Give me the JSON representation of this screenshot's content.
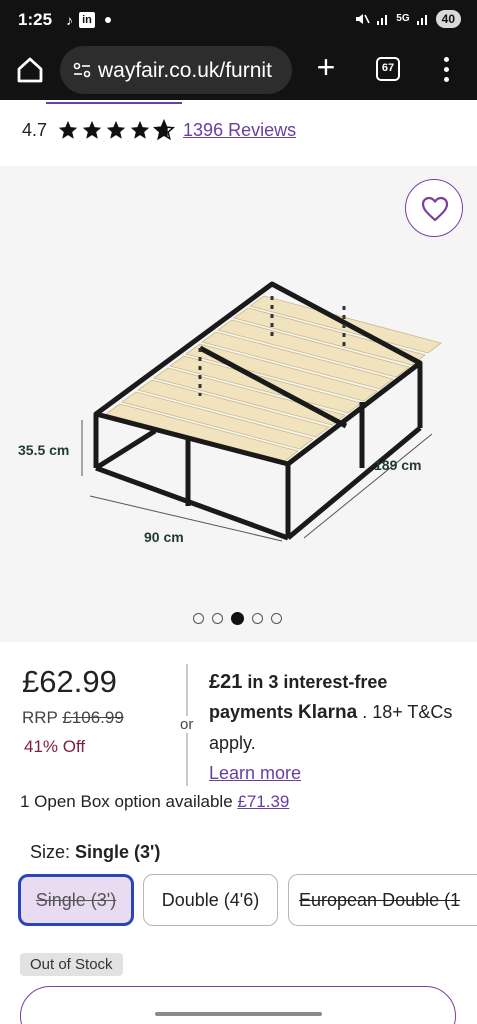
{
  "status_bar": {
    "time": "1:25",
    "left_icons": [
      "tiktok-icon",
      "linkedin-icon",
      "notification-dot-icon"
    ],
    "linkedin_text": "in",
    "right_icons": [
      "mute-icon",
      "signal-icon",
      "5g-icon",
      "signal-icon"
    ],
    "network": "5G",
    "battery": "40"
  },
  "browser": {
    "url": "wayfair.co.uk/furnit",
    "tab_count": "67",
    "plus": "+"
  },
  "rating": {
    "value": "4.7",
    "stars": 4.7,
    "reviews": "1396 Reviews"
  },
  "gallery": {
    "dim_height": "35.5 cm",
    "dim_length": "189 cm",
    "dim_width": "90 cm",
    "image_count": 5,
    "active_index": 2
  },
  "price": {
    "current": "£62.99",
    "rrp_label": "RRP",
    "rrp_value": "£106.99",
    "discount": "41% Off",
    "or": "or"
  },
  "klarna": {
    "amount": "£21",
    "text1": " in 3 interest-free payments ",
    "brand": "Klarna",
    "text2": " . 18+ T&Cs apply.",
    "learn_more": "Learn more"
  },
  "open_box": {
    "text": "1 Open Box option available ",
    "price": "£71.39"
  },
  "size": {
    "label": "Size: ",
    "selected": "Single (3')",
    "options": [
      {
        "label": "Single (3')"
      },
      {
        "label": "Double (4'6)"
      },
      {
        "label": "European Double (1"
      }
    ]
  },
  "stock": "Out of Stock",
  "colors": {
    "accent_purple": "#6a3ea1",
    "discount_red": "#7d1d3f",
    "selected_border": "#2a45b8",
    "selected_fill": "#e9dcf2"
  }
}
